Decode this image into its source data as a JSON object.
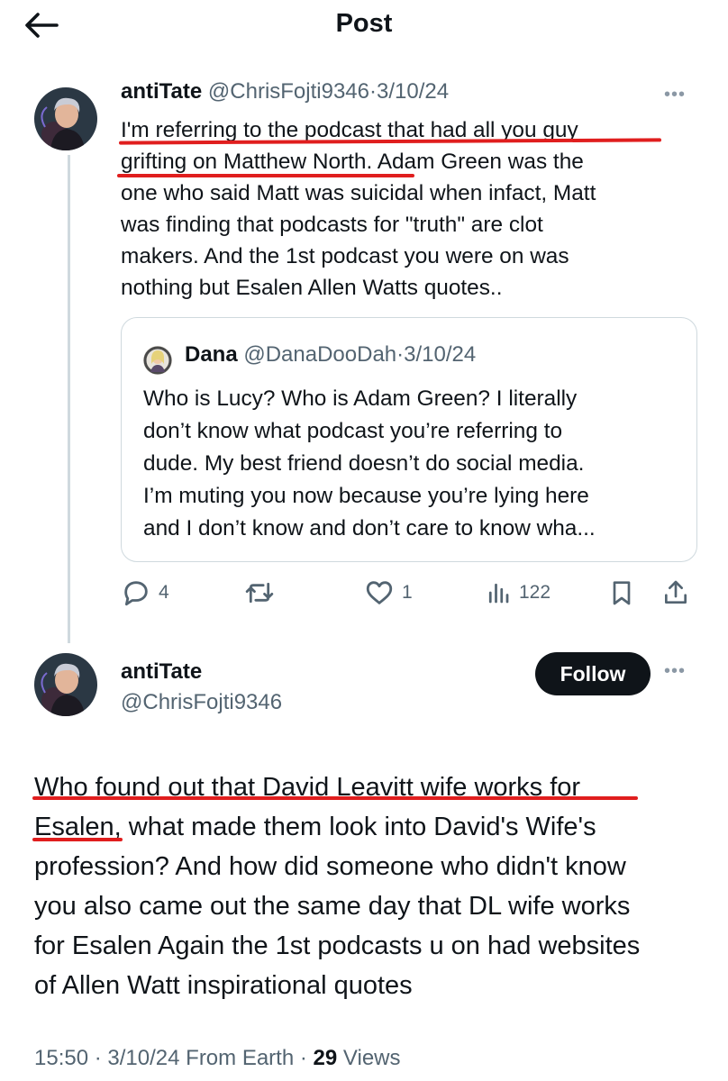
{
  "header": {
    "title": "Post",
    "back_icon": "arrow-left-icon"
  },
  "reply_tweet": {
    "display_name": "antiTate",
    "handle": "@ChrisFojti9346",
    "separator": "·",
    "date": "3/10/24",
    "body_lines": [
      "I'm referring to the podcast that had all you guy",
      "grifting on Matthew North",
      ". Adam Green was the",
      "one who said Matt was suicidal when infact, Matt",
      "was finding that podcasts for \"truth\" are clot",
      "makers. And the 1st podcast you were on was",
      "nothing but Esalen Allen Watts quotes.."
    ],
    "quoted_tweet": {
      "display_name": "Dana",
      "handle": "@DanaDooDah",
      "separator": "·",
      "date": "3/10/24",
      "body_lines": [
        "Who is Lucy? Who is Adam Green? I literally",
        "don’t know what podcast you’re referring to",
        "dude. My best friend doesn’t do social media.",
        "I’m muting you now because you’re lying here",
        "and I don’t know and don’t care to know wha..."
      ]
    },
    "actions": {
      "replies": "4",
      "retweets": "",
      "likes": "1",
      "views": "122"
    }
  },
  "main_tweet": {
    "display_name": "antiTate",
    "handle": "@ChrisFojti9346",
    "follow_label": "Follow",
    "body_lines": [
      "Who found out that David Leavitt wife works for",
      "Esalen,",
      " what made them look into David's Wife's",
      "profession? And how did someone who didn't know",
      "you also came out the same day that DL wife works",
      "for Esalen Again the 1st podcasts u on had websites",
      "of Allen Watt inspirational quotes"
    ],
    "footer": {
      "time": "15:50",
      "date": "3/10/24",
      "source": "From Earth",
      "separator": "·",
      "views_count": "29",
      "views_label": "Views"
    }
  },
  "colors": {
    "text": "#0f1419",
    "secondary_text": "#536471",
    "annotation_underline": "#e01e1e",
    "follow_button_bg": "#0f1419",
    "border": "#cfd9de"
  },
  "icons": [
    "arrow-left-icon",
    "more-icon",
    "reply-icon",
    "retweet-icon",
    "like-icon",
    "views-icon",
    "bookmark-icon",
    "share-icon"
  ]
}
